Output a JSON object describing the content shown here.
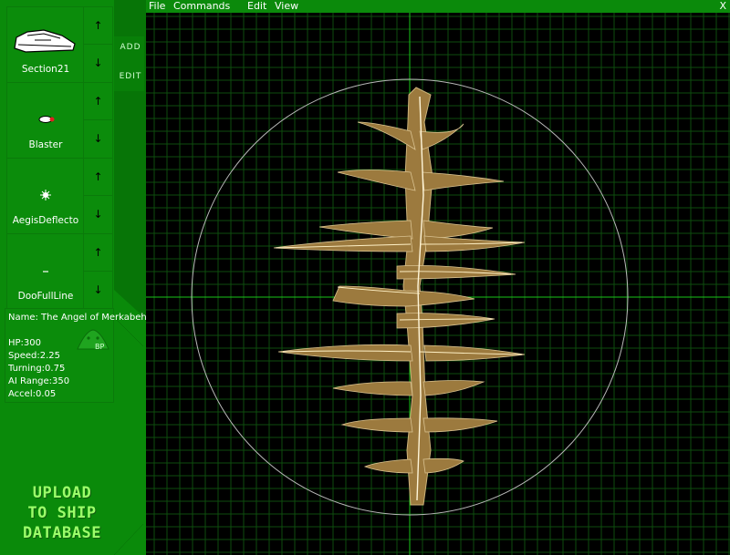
{
  "menu": {
    "file": "File",
    "commands": "Commands",
    "edit": "Edit",
    "view": "View",
    "close": "X"
  },
  "components": [
    {
      "label": "Section21",
      "icon": "ship-section-icon",
      "up": "↑",
      "down": "↓"
    },
    {
      "label": "Blaster",
      "icon": "blaster-icon",
      "up": "↑",
      "down": "↓"
    },
    {
      "label": "AegisDeflecto",
      "icon": "deflector-icon",
      "up": "↑",
      "down": "↓"
    },
    {
      "label": "DooFullLine",
      "icon": "line-icon",
      "up": "↑",
      "down": "↓"
    }
  ],
  "tabs": {
    "add": "ADD",
    "edit": "EDIT"
  },
  "ship": {
    "name": "Name: The Angel of Merkabeh",
    "hp": "HP:300",
    "speed": "Speed:2.25",
    "turning": "Turning:0.75",
    "ai_range": "AI Range:350",
    "accel": "Accel:0.05",
    "badge": "BP"
  },
  "upload": {
    "line1": "UPLOAD",
    "line2": "TO SHIP",
    "line3": "DATABASE"
  },
  "colors": {
    "panel_green": "#0b8c0b",
    "grid_green": "#0e4d0e",
    "axis_green": "#18c418",
    "ship_gold": "#9c7a3e",
    "upload_text": "#9cff6a"
  }
}
